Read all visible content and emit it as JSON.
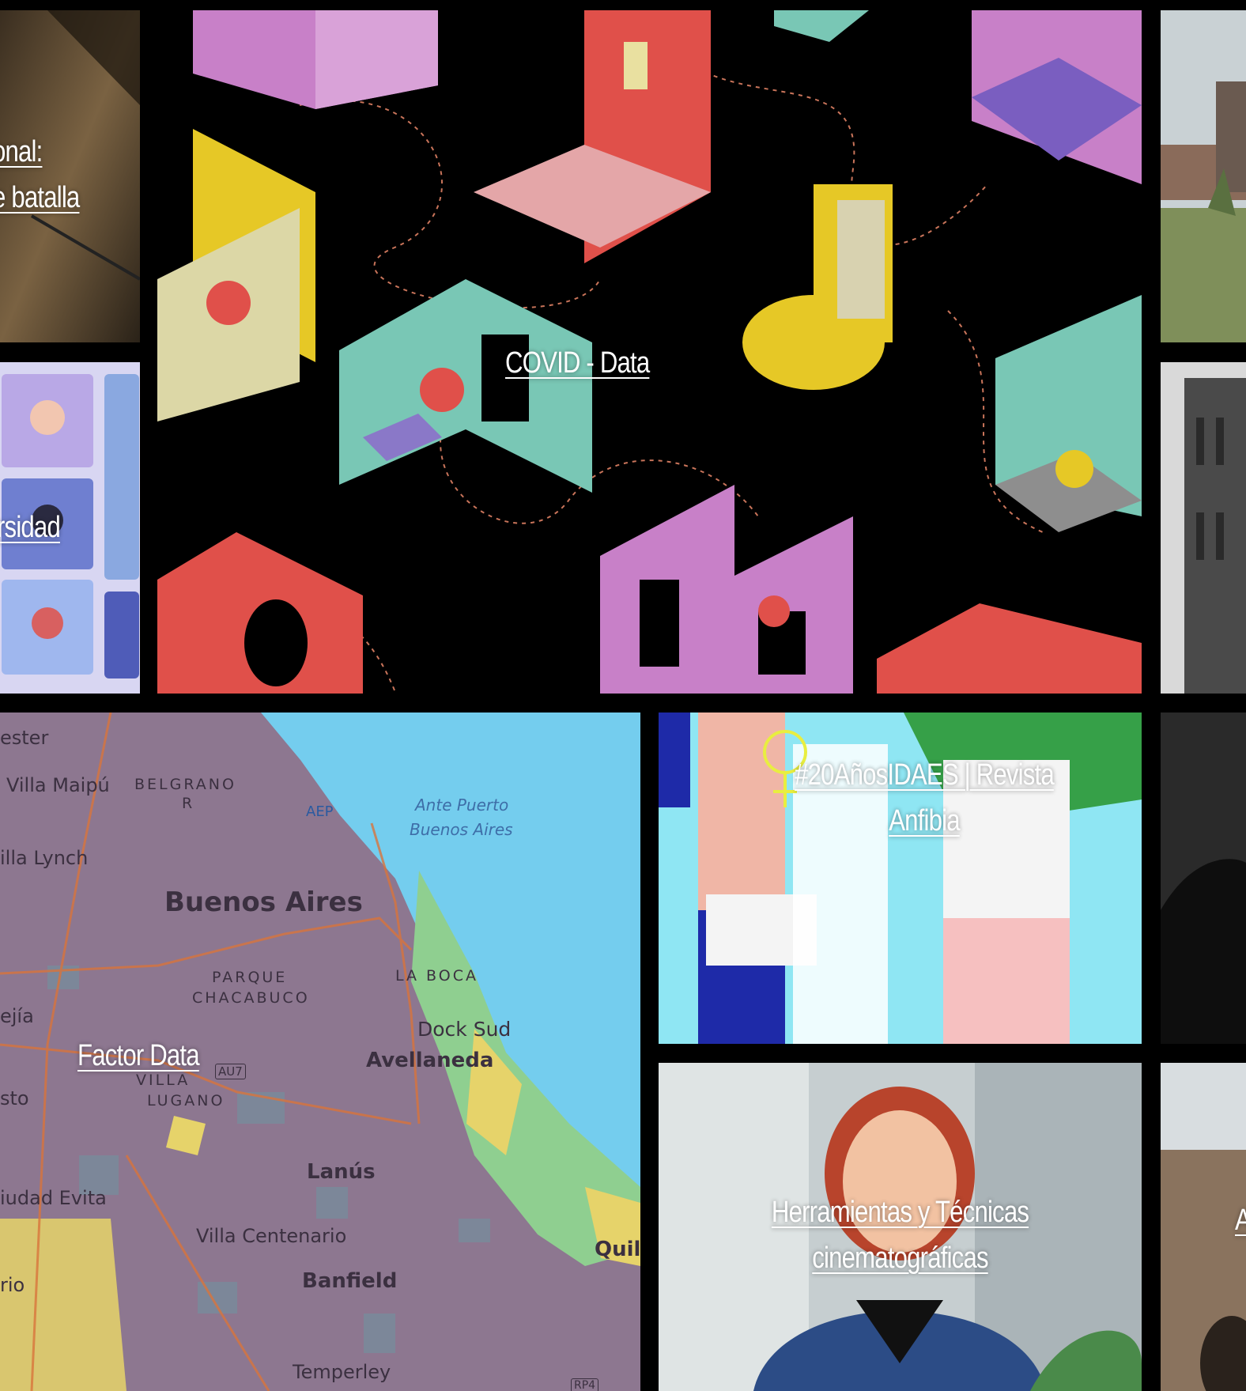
{
  "tiles": {
    "left_top": {
      "caption_line1": "onal:",
      "caption_line2": "e batalla"
    },
    "left_mid": {
      "caption": "rsidad"
    },
    "covid": {
      "caption": "COVID - Data"
    },
    "map": {
      "caption": "Factor Data",
      "labels": {
        "ester": "ester",
        "villa_maipu": "Villa Maipú",
        "belgrano": "BELGRANO",
        "r": "R",
        "aep": "AEP",
        "ante_puerto_1": "Ante Puerto",
        "ante_puerto_2": "Buenos Aires",
        "villa_lynch": "illa Lynch",
        "buenos_aires": "Buenos Aires",
        "parque": "PARQUE",
        "chacabuco": "CHACABUCO",
        "la_boca": "LA BOCA",
        "dock_sud": "Dock Sud",
        "ejia": "ejía",
        "avellaneda": "Avellaneda",
        "villa": "VILLA",
        "lugano": "LUGANO",
        "au7": "AU7",
        "sto": "sto",
        "lanus": "Lanús",
        "ciudad_evita": "iudad Evita",
        "villa_centenario": "Villa Centenario",
        "quil": "Quil",
        "rio": "rio",
        "banfield": "Banfield",
        "temperley": "Temperley",
        "rp4": "RP4"
      }
    },
    "mujeres": {
      "caption_line1": "#20AñosIDAES | Revista",
      "caption_line2": "Anfibia"
    },
    "herramientas": {
      "caption_line1": "Herramientas y Técnicas",
      "caption_line2": "cinematográficas"
    },
    "right_bot": {
      "caption": "A"
    }
  },
  "colors": {
    "background": "#000000",
    "caption": "#ffffff",
    "map_land": "#8d7790",
    "map_water": "#74cdee",
    "covid_pink": "#c880c8",
    "covid_red": "#e0504a",
    "covid_yellow": "#e6c826",
    "covid_teal": "#79c7b5",
    "mujeres_bg": "#8fe6f3"
  }
}
